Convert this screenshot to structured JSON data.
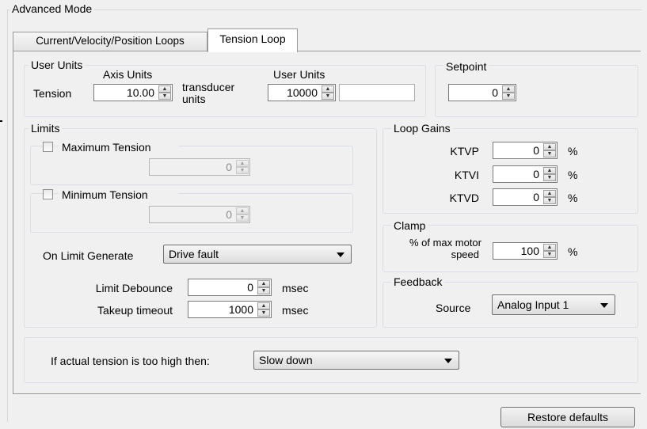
{
  "window": {
    "title": "Advanced Mode"
  },
  "tabs": [
    {
      "label": "Current/Velocity/Position Loops"
    },
    {
      "label": "Tension Loop"
    }
  ],
  "user_units": {
    "group_label": "User Units",
    "axis_units_header": "Axis Units",
    "user_units_header": "User Units",
    "tension_label": "Tension",
    "tension_value": "10.00",
    "transducer_units_label_1": "transducer",
    "transducer_units_label_2": "units",
    "user_units_value": "10000",
    "user_units_text": ""
  },
  "setpoint": {
    "group_label": "Setpoint",
    "value": "0"
  },
  "limits": {
    "group_label": "Limits",
    "max_tension_label": "Maximum Tension",
    "max_tension_value": "0",
    "min_tension_label": "Minimum Tension",
    "min_tension_value": "0",
    "on_limit_label": "On Limit Generate",
    "on_limit_value": "Drive fault",
    "debounce_label": "Limit Debounce",
    "debounce_value": "0",
    "debounce_unit": "msec",
    "takeup_label": "Takeup timeout",
    "takeup_value": "1000",
    "takeup_unit": "msec"
  },
  "loop_gains": {
    "group_label": "Loop Gains",
    "ktvp_label": "KTVP",
    "ktvp_value": "0",
    "ktvi_label": "KTVI",
    "ktvi_value": "0",
    "ktvd_label": "KTVD",
    "ktvd_value": "0",
    "unit": "%"
  },
  "clamp": {
    "group_label": "Clamp",
    "label_1": "% of max motor",
    "label_2": "speed",
    "value": "100",
    "unit": "%"
  },
  "feedback": {
    "group_label": "Feedback",
    "source_label": "Source",
    "source_value": "Analog Input 1"
  },
  "tension_high": {
    "label": "If actual tension is too high then:",
    "value": "Slow down"
  },
  "footer": {
    "restore_label": "Restore defaults"
  }
}
